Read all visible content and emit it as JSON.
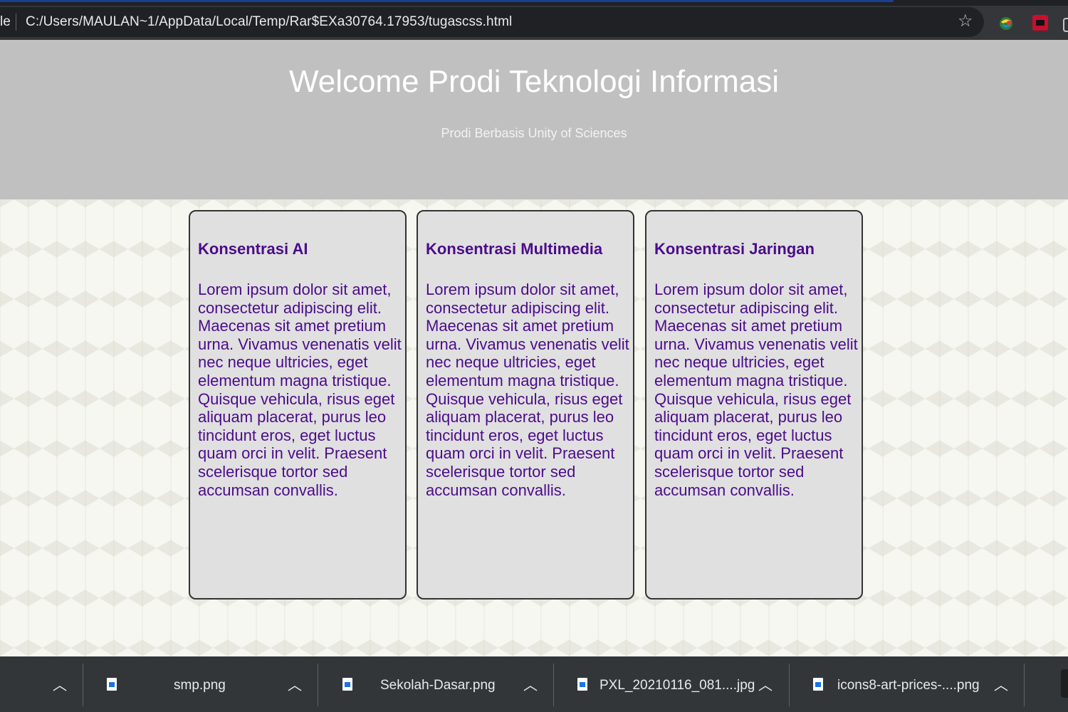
{
  "browser": {
    "tab_edge_label": "le",
    "url": "C:/Users/MAULAN~1/AppData/Local/Temp/Rar$EXa30764.17953/tugascss.html",
    "bookmark_icon": "star-icon",
    "extensions": [
      "colorful-extension-icon",
      "red-extension-icon",
      "partial-extension-icon"
    ]
  },
  "header": {
    "title": "Welcome Prodi Teknologi Informasi",
    "subtitle": "Prodi Berbasis Unity of Sciences"
  },
  "cards": [
    {
      "title": "Konsentrasi AI",
      "body": "Lorem ipsum dolor sit amet, consectetur adipiscing elit. Maecenas sit amet pretium urna. Vivamus venenatis velit nec neque ultricies, eget elementum magna tristique. Quisque vehicula, risus eget aliquam placerat, purus leo tincidunt eros, eget luctus quam orci in velit. Praesent scelerisque tortor sed accumsan convallis."
    },
    {
      "title": "Konsentrasi Multimedia",
      "body": "Lorem ipsum dolor sit amet, consectetur adipiscing elit. Maecenas sit amet pretium urna. Vivamus venenatis velit nec neque ultricies, eget elementum magna tristique. Quisque vehicula, risus eget aliquam placerat, purus leo tincidunt eros, eget luctus quam orci in velit. Praesent scelerisque tortor sed accumsan convallis."
    },
    {
      "title": "Konsentrasi Jaringan",
      "body": "Lorem ipsum dolor sit amet, consectetur adipiscing elit. Maecenas sit amet pretium urna. Vivamus venenatis velit nec neque ultricies, eget elementum magna tristique. Quisque vehicula, risus eget aliquam placerat, purus leo tincidunt eros, eget luctus quam orci in velit. Praesent scelerisque tortor sed accumsan convallis."
    }
  ],
  "downloads": [
    {
      "name": "smp.png"
    },
    {
      "name": "Sekolah-Dasar.png"
    },
    {
      "name": "PXL_20210116_081....jpg"
    },
    {
      "name": "icons8-art-prices-....png"
    }
  ],
  "colors": {
    "header_bg": "#c0c0c0",
    "card_bg": "#e0e0e0",
    "card_text": "#4b0c8a",
    "download_bar_bg": "#323639"
  }
}
